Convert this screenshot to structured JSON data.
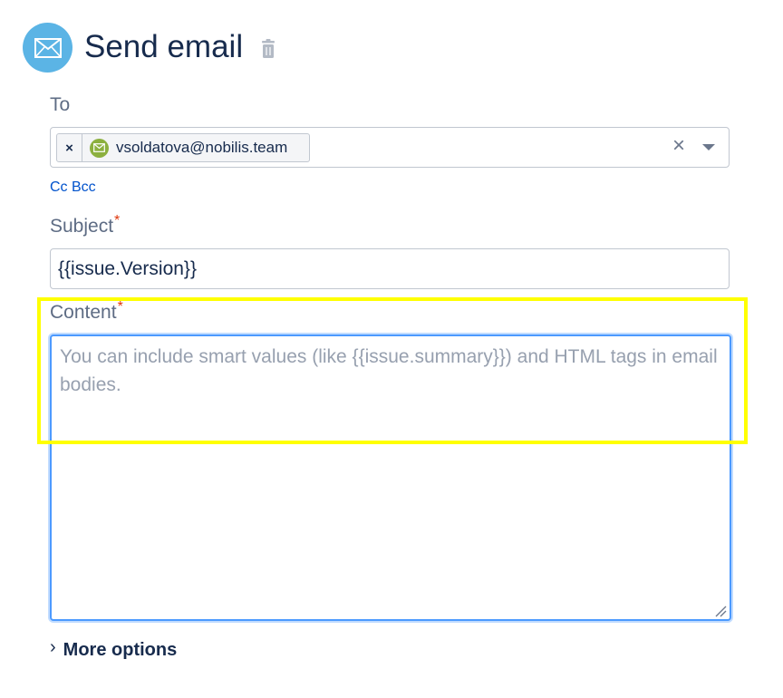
{
  "header": {
    "title": "Send email",
    "icon": "envelope-icon",
    "delete_icon": "trash-icon"
  },
  "to": {
    "label": "To",
    "recipients": [
      {
        "email": "vsoldatova@nobilis.team",
        "remove": "×",
        "avatar_icon": "envelope-icon"
      }
    ],
    "clear": "×"
  },
  "ccbcc": "Cc Bcc",
  "subject": {
    "label": "Subject",
    "required": "*",
    "value": "{{issue.Version}}"
  },
  "content": {
    "label": "Content",
    "required": "*",
    "value": "",
    "placeholder": "You can include smart values (like {{issue.summary}}) and HTML tags in email bodies."
  },
  "more_options": {
    "chevron": "›",
    "label": "More options"
  },
  "colors": {
    "accent": "#5bb4e5",
    "link": "#0052cc",
    "required": "#de350b",
    "focus": "#4c9aff",
    "highlight": "#ffff00",
    "avatar": "#8cb03f"
  }
}
